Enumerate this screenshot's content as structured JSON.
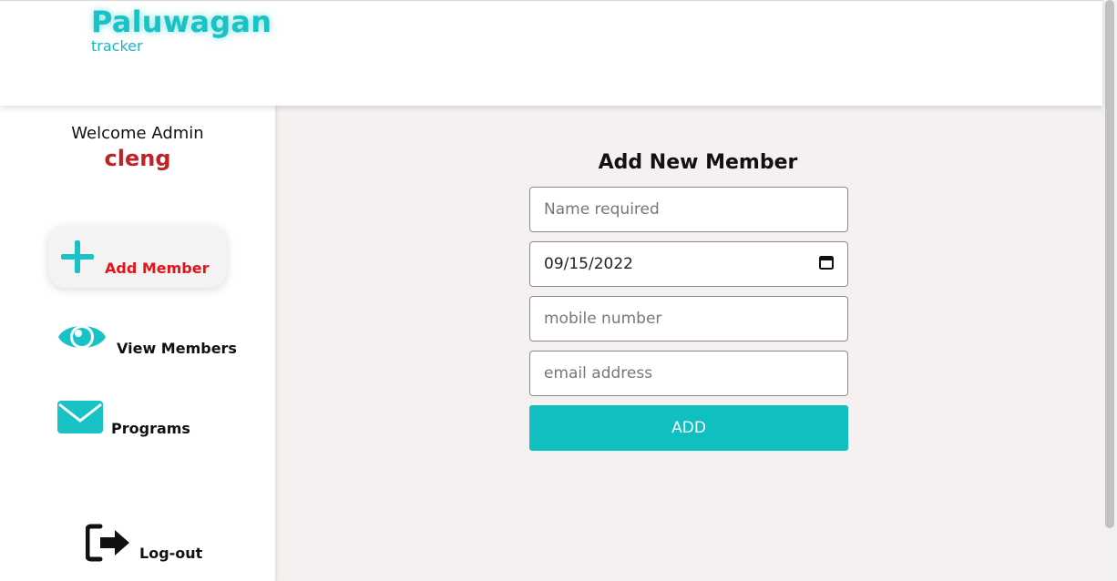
{
  "header": {
    "brand": "Paluwagan",
    "tagline": "tracker"
  },
  "sidebar": {
    "welcome": "Welcome Admin",
    "username": "cleng",
    "items": [
      {
        "label": "Add Member",
        "icon": "plus-icon",
        "active": true
      },
      {
        "label": "View Members",
        "icon": "eye-icon"
      },
      {
        "label": "Programs",
        "icon": "envelope-icon"
      },
      {
        "label": "Log-out",
        "icon": "logout-icon"
      }
    ]
  },
  "form": {
    "title": "Add New Member",
    "name_placeholder": "Name required",
    "date_value": "09/15/2022",
    "mobile_placeholder": "mobile number",
    "email_placeholder": "email address",
    "submit_label": "ADD"
  },
  "colors": {
    "brand": "#19c2c4",
    "accent": "#10bfbf",
    "active_label": "#e2141e",
    "username": "#c0222a",
    "main_bg": "#f5f1f0"
  }
}
